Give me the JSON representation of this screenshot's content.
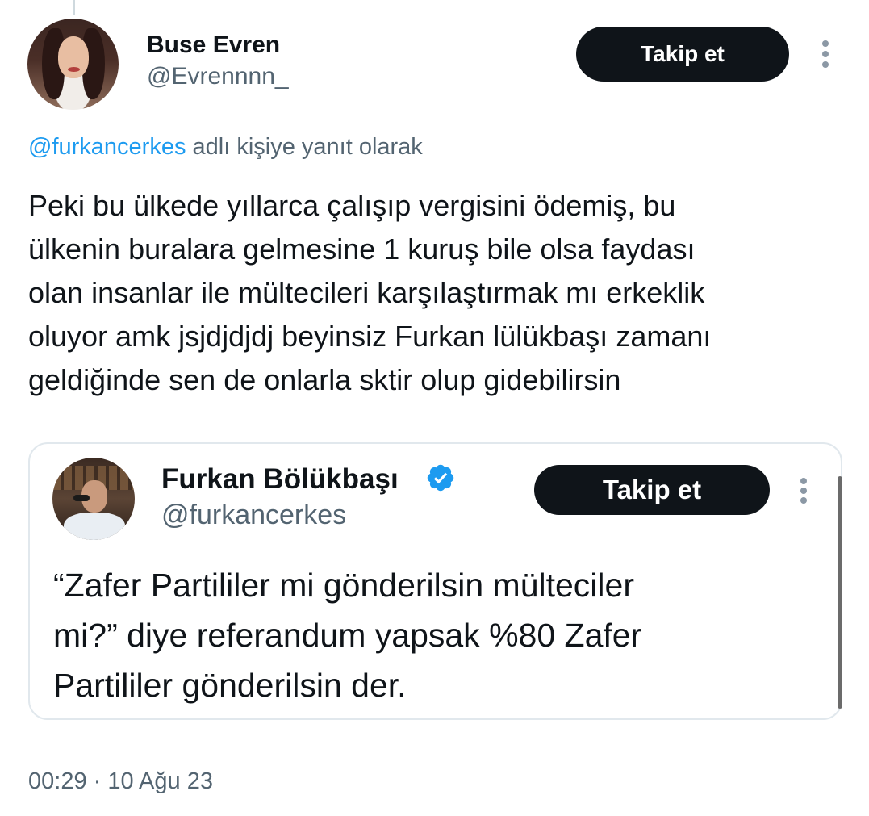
{
  "tweet": {
    "author": {
      "name": "Buse Evren",
      "handle": "@Evrennnn_"
    },
    "follow_label": "Takip et",
    "reply_context": {
      "mention": "@furkancerkes",
      "suffix": " adlı kişiye yanıt olarak"
    },
    "text_lines": [
      "Peki bu ülkede yıllarca çalışıp vergisini ödemiş, bu",
      "ülkenin buralara gelmesine 1 kuruş bile olsa faydası",
      "olan insanlar ile mültecileri karşılaştırmak mı erkeklik",
      "oluyor amk jsjdjdjdj beyinsiz Furkan lülükbaşı zamanı",
      "geldiğinde sen de onlarla sktir olup gidebilirsin"
    ],
    "timestamp": "00:29 · 10 Ağu 23"
  },
  "quoted": {
    "author": {
      "name": "Furkan Bölükbaşı",
      "handle": "@furkancerkes",
      "verified": true
    },
    "follow_label": "Takip et",
    "text_lines": [
      "“Zafer Partililer mi gönderilsin mülteciler",
      "mi?” diye referandum yapsak %80 Zafer",
      "Partililer gönderilsin der."
    ]
  },
  "icons": {
    "more": "more-vertical-icon",
    "verified": "verified-badge-icon"
  },
  "colors": {
    "link": "#1d9bf0",
    "secondary_text": "#536471",
    "button_bg": "#0f1419",
    "verified": "#1d9bf0"
  }
}
